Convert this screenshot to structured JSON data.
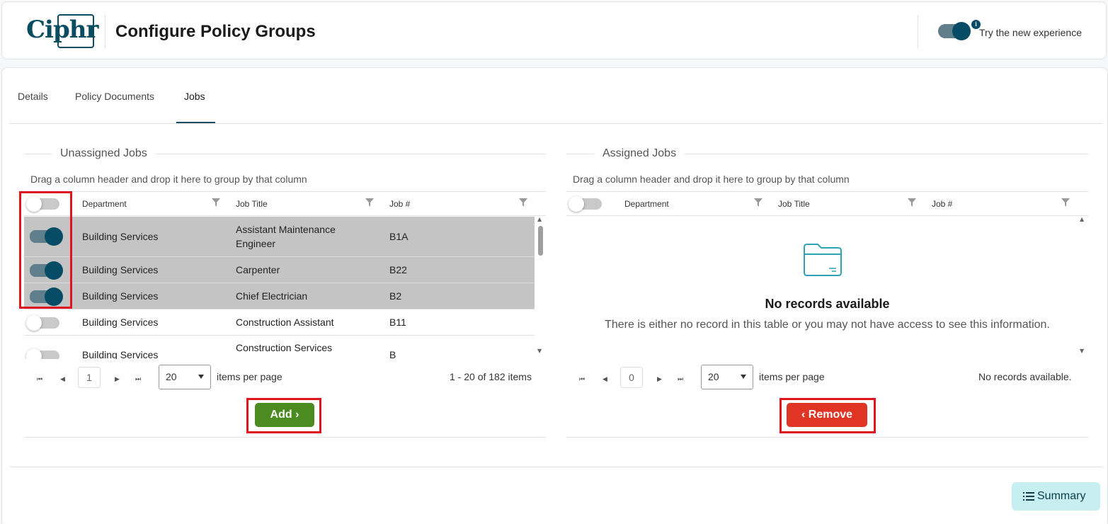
{
  "header": {
    "logo_text": "Ciphr",
    "title": "Configure Policy Groups",
    "new_experience": {
      "label": "Try the new experience",
      "enabled": true,
      "info_icon": "info-icon"
    }
  },
  "tabs": [
    {
      "label": "Details",
      "active": false
    },
    {
      "label": "Policy Documents",
      "active": false
    },
    {
      "label": "Jobs",
      "active": true
    }
  ],
  "unassigned": {
    "legend": "Unassigned Jobs",
    "drag_hint": "Drag a column header and drop it here to group by that column",
    "columns": [
      "Department",
      "Job Title",
      "Job #"
    ],
    "rows": [
      {
        "department": "Building Services",
        "job_title_line1": "Assistant Maintenance",
        "job_title_line2": "Engineer",
        "job_no": "B1A",
        "selected": true
      },
      {
        "department": "Building Services",
        "job_title_line1": "Carpenter",
        "job_title_line2": "",
        "job_no": "B22",
        "selected": true
      },
      {
        "department": "Building Services",
        "job_title_line1": "Chief Electrician",
        "job_title_line2": "",
        "job_no": "B2",
        "selected": true
      },
      {
        "department": "Building Services",
        "job_title_line1": "Construction Assistant",
        "job_title_line2": "",
        "job_no": "B11",
        "selected": false
      },
      {
        "department": "Building Services",
        "job_title_line1": "Construction Services",
        "job_title_line2": "",
        "job_no": "B",
        "selected": false
      }
    ],
    "pager": {
      "page": "1",
      "page_size": "20",
      "items_per_page_label": "items per page",
      "summary": "1 - 20 of 182 items"
    },
    "add_label": "Add"
  },
  "assigned": {
    "legend": "Assigned Jobs",
    "drag_hint": "Drag a column header and drop it here to group by that column",
    "columns": [
      "Department",
      "Job Title",
      "Job #"
    ],
    "empty_title": "No records available",
    "empty_text": "There is either no record in this table or you may not have access to see this information.",
    "pager": {
      "page": "0",
      "page_size": "20",
      "items_per_page_label": "items per page",
      "summary": "No records available."
    },
    "remove_label": "Remove"
  },
  "summary_label": "Summary",
  "colors": {
    "brand": "#0b4d60",
    "add": "#4b8b1f",
    "remove": "#e03424",
    "highlight_frame": "#e0141e",
    "selected_row": "#c4c4c4"
  }
}
